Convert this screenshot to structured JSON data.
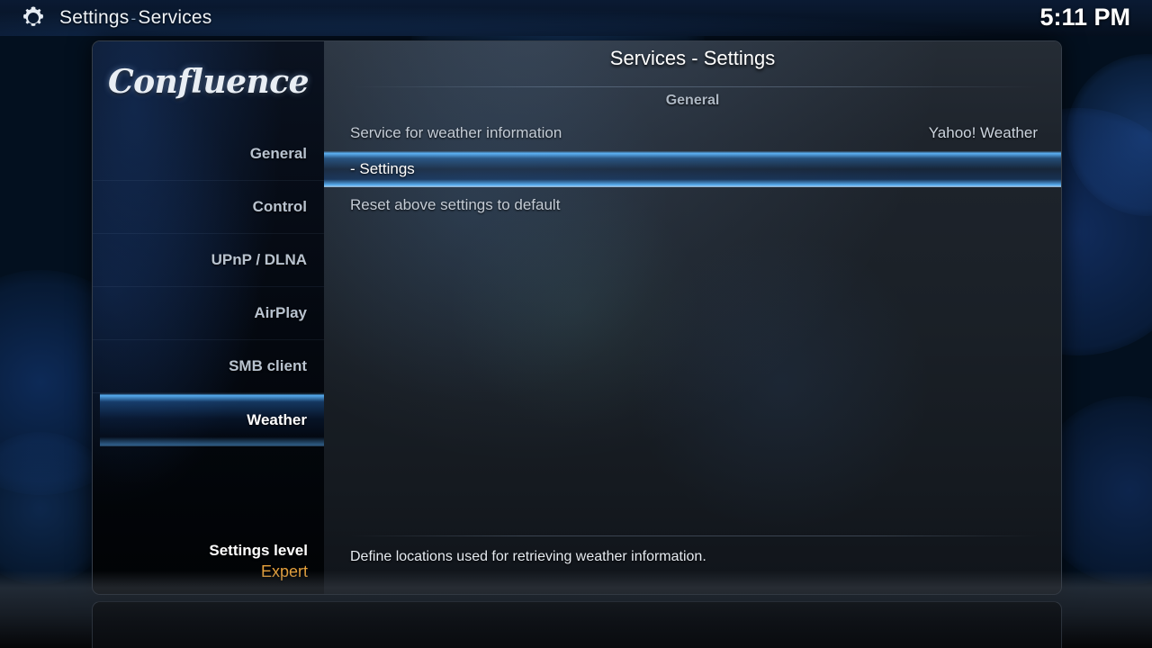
{
  "topbar": {
    "icon": "gear-icon",
    "title": "Settings",
    "separator": "-",
    "subtitle": "Services",
    "clock": "5:11 PM"
  },
  "sidebar": {
    "logo": "Confluence",
    "items": [
      {
        "label": "General",
        "selected": false
      },
      {
        "label": "Control",
        "selected": false
      },
      {
        "label": "UPnP / DLNA",
        "selected": false
      },
      {
        "label": "AirPlay",
        "selected": false
      },
      {
        "label": "SMB client",
        "selected": false
      },
      {
        "label": "Weather",
        "selected": true
      }
    ],
    "settings_level": {
      "title": "Settings level",
      "value": "Expert",
      "value_color": "#e8a33d"
    }
  },
  "content": {
    "title": "Services - Settings",
    "section": "General",
    "rows": [
      {
        "label": "Service for weather information",
        "value": "Yahoo! Weather",
        "focused": false
      },
      {
        "label": "- Settings",
        "value": "",
        "focused": true
      },
      {
        "label": "Reset above settings to default",
        "value": "",
        "focused": false
      }
    ],
    "description": "Define locations used for retrieving weather information."
  },
  "colors": {
    "accent_blue": "#5ab4ff",
    "highlight_orange": "#e8a33d",
    "text_primary": "#ffffff",
    "text_secondary": "#c4ccd6",
    "background": "#03101f"
  }
}
